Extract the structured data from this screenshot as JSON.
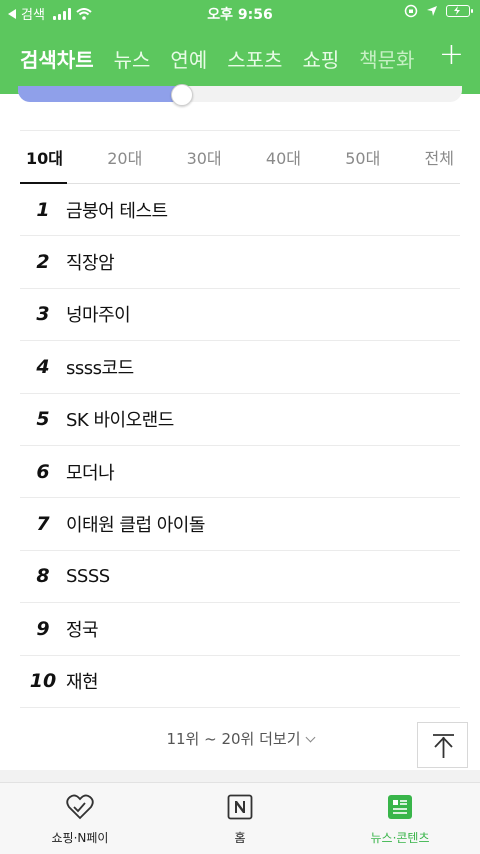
{
  "status_bar": {
    "back_label": "검색",
    "time": "오후 9:56"
  },
  "nav": {
    "tabs": [
      {
        "label": "검색차트",
        "active": true
      },
      {
        "label": "뉴스"
      },
      {
        "label": "연예"
      },
      {
        "label": "스포츠"
      },
      {
        "label": "쇼핑"
      },
      {
        "label": "책문화"
      }
    ],
    "plus_label": "+"
  },
  "slider": {
    "fraction": 0.37
  },
  "age_tabs": [
    "10대",
    "20대",
    "30대",
    "40대",
    "50대",
    "전체"
  ],
  "active_age": "10대",
  "rankings": [
    {
      "rank": "1",
      "keyword": "금붕어 테스트"
    },
    {
      "rank": "2",
      "keyword": "직장암"
    },
    {
      "rank": "3",
      "keyword": "넝마주이"
    },
    {
      "rank": "4",
      "keyword": "ssss코드"
    },
    {
      "rank": "5",
      "keyword": "SK 바이오랜드"
    },
    {
      "rank": "6",
      "keyword": "모더나"
    },
    {
      "rank": "7",
      "keyword": "이태원 클럽 아이돌"
    },
    {
      "rank": "8",
      "keyword": "SSSS"
    },
    {
      "rank": "9",
      "keyword": "정국"
    },
    {
      "rank": "10",
      "keyword": "재현"
    }
  ],
  "more_label": "11위 ~ 20위 더보기",
  "bottom_nav": [
    {
      "label": "쇼핑·N페이",
      "icon": "heart-icon"
    },
    {
      "label": "홈",
      "icon": "naver-n-icon"
    },
    {
      "label": "뉴스·콘텐츠",
      "icon": "news-icon",
      "active": true
    }
  ],
  "colors": {
    "brand_green": "#5cc75e",
    "active_green": "#39b54a",
    "slider_fill": "#8fa0ea"
  }
}
